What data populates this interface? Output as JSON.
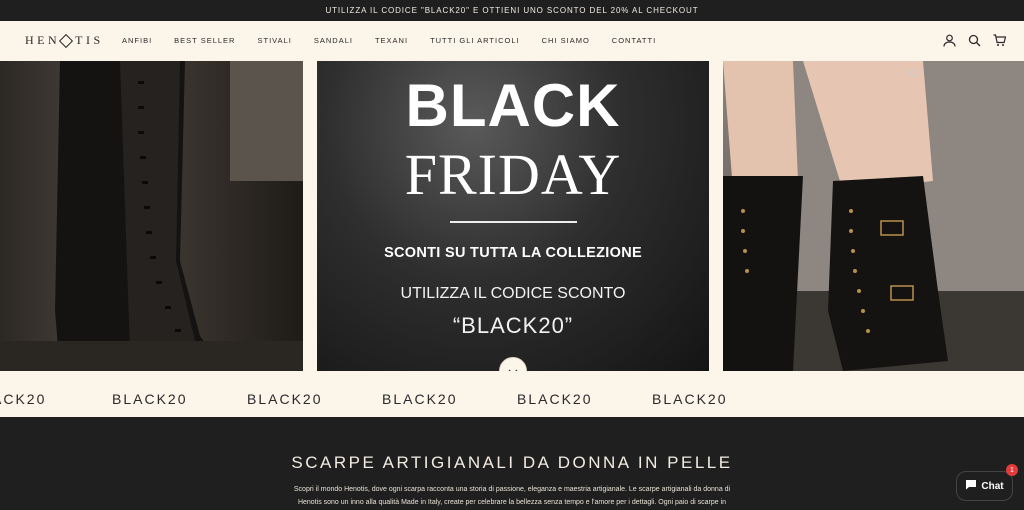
{
  "announcement": "UTILIZZA IL CODICE \"BLACK20\" E OTTIENI UNO SCONTO DEL 20% AL CHECKOUT",
  "logo": {
    "left": "HEN",
    "right": "TIS"
  },
  "nav": [
    "ANFIBI",
    "BEST SELLER",
    "STIVALI",
    "SANDALI",
    "TEXANI",
    "TUTTI GLI ARTICOLI",
    "CHI SIAMO",
    "CONTATTI"
  ],
  "icons": {
    "account": "user-icon",
    "search": "search-icon",
    "cart": "cart-icon"
  },
  "hero": {
    "line1": "BLACK",
    "line2": "FRIDAY",
    "line3": "SCONTI SU TUTTA LA COLLEZIONE",
    "line4": "UTILIZZA IL CODICE SCONTO",
    "line5": "“BLACK20”"
  },
  "marquee": [
    "ACK20",
    "BLACK20",
    "BLACK20",
    "BLACK20",
    "BLACK20",
    "BLACK20"
  ],
  "section": {
    "title": "SCARPE ARTIGIANALI DA DONNA IN PELLE",
    "text1": "Scopri il mondo Henotis, dove ogni scarpa racconta una storia di passione, eleganza e maestria artigianale. Le scarpe artigianali da donna di",
    "text2": "Henotis sono un inno alla qualità Made in Italy, create per celebrare la bellezza senza tempo e l'amore per i dettagli. Ogni paio di scarpe in"
  },
  "chat": {
    "label": "Chat",
    "badge": "1"
  },
  "colors": {
    "dark": "#1f1f1f",
    "cream": "#fbf5ea",
    "badge": "#e23b3b"
  }
}
